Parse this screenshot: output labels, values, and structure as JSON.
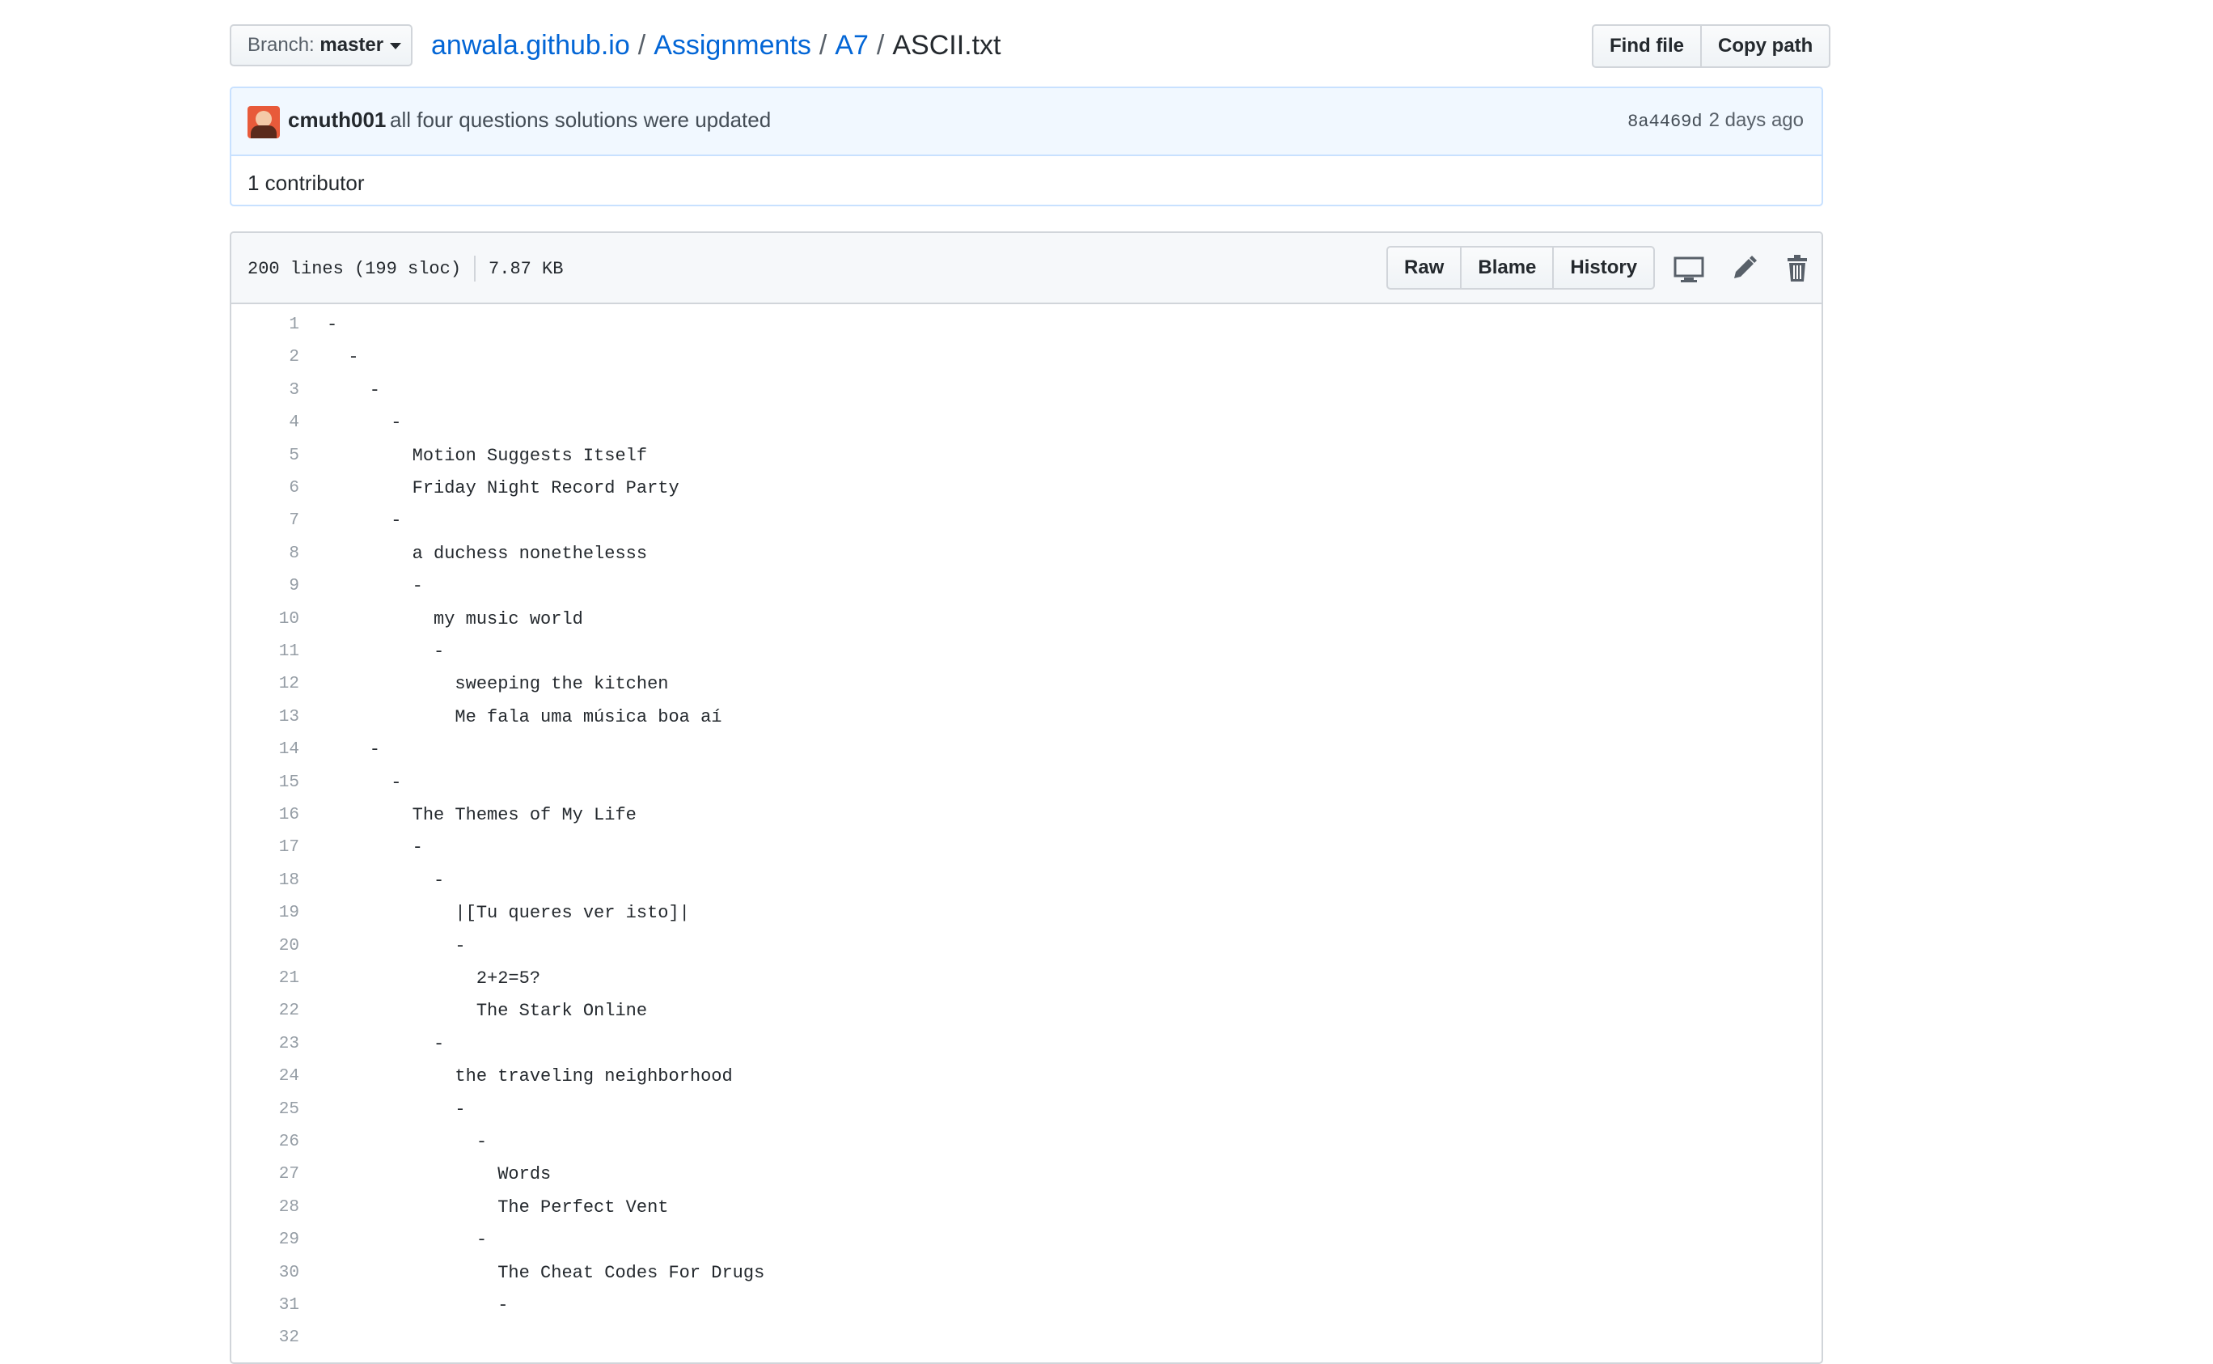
{
  "branch": {
    "label": "Branch:",
    "value": "master"
  },
  "breadcrumb": {
    "repo": "anwala.github.io",
    "sep": "/",
    "folder1": "Assignments",
    "folder2": "A7",
    "file": "ASCII.txt"
  },
  "header_buttons": {
    "find_file": "Find file",
    "copy_path": "Copy path"
  },
  "commit": {
    "author": "cmuth001",
    "message": "all four questions solutions were updated",
    "sha": "8a4469d",
    "time": "2 days ago"
  },
  "contributors": "1 contributor",
  "file": {
    "lines_info": "200 lines (199 sloc)",
    "size": "7.87 KB",
    "raw": "Raw",
    "blame": "Blame",
    "history": "History"
  },
  "code": [
    {
      "n": "1",
      "t": "-"
    },
    {
      "n": "2",
      "t": "  -"
    },
    {
      "n": "3",
      "t": "    -"
    },
    {
      "n": "4",
      "t": "      -"
    },
    {
      "n": "5",
      "t": "        Motion Suggests Itself"
    },
    {
      "n": "6",
      "t": "        Friday Night Record Party"
    },
    {
      "n": "7",
      "t": "      -"
    },
    {
      "n": "8",
      "t": "        a duchess nonethelesss"
    },
    {
      "n": "9",
      "t": "        -"
    },
    {
      "n": "10",
      "t": "          my music world"
    },
    {
      "n": "11",
      "t": "          -"
    },
    {
      "n": "12",
      "t": "            sweeping the kitchen"
    },
    {
      "n": "13",
      "t": "            Me fala uma música boa aí"
    },
    {
      "n": "14",
      "t": "    -"
    },
    {
      "n": "15",
      "t": "      -"
    },
    {
      "n": "16",
      "t": "        The Themes of My Life"
    },
    {
      "n": "17",
      "t": "        -"
    },
    {
      "n": "18",
      "t": "          -"
    },
    {
      "n": "19",
      "t": "            |[Tu queres ver isto]|"
    },
    {
      "n": "20",
      "t": "            -"
    },
    {
      "n": "21",
      "t": "              2+2=5?"
    },
    {
      "n": "22",
      "t": "              The Stark Online"
    },
    {
      "n": "23",
      "t": "          -"
    },
    {
      "n": "24",
      "t": "            the traveling neighborhood"
    },
    {
      "n": "25",
      "t": "            -"
    },
    {
      "n": "26",
      "t": "              -"
    },
    {
      "n": "27",
      "t": "                Words"
    },
    {
      "n": "28",
      "t": "                The Perfect Vent"
    },
    {
      "n": "29",
      "t": "              -"
    },
    {
      "n": "30",
      "t": "                The Cheat Codes For Drugs"
    },
    {
      "n": "31",
      "t": "                -"
    },
    {
      "n": "32",
      "t": ""
    }
  ]
}
